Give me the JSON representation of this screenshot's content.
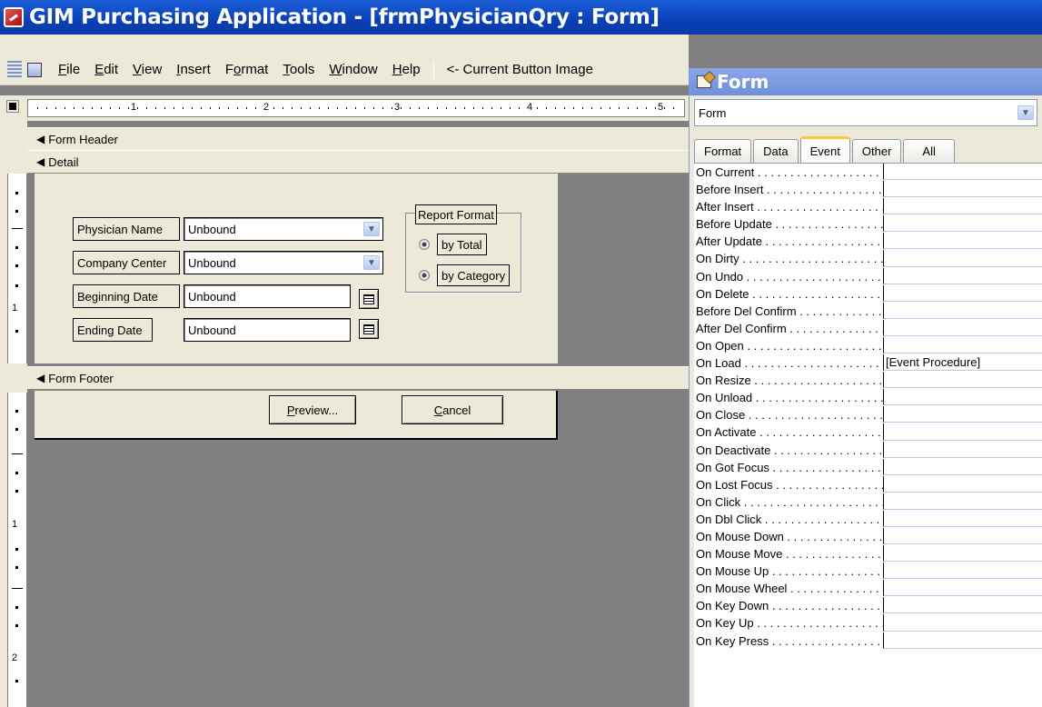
{
  "window": {
    "title": "GIM Purchasing Application - [frmPhysicianQry : Form]"
  },
  "menu": {
    "items": [
      {
        "label": "File",
        "accel": "F",
        "rest": "ile"
      },
      {
        "label": "Edit",
        "accel": "E",
        "rest": "dit"
      },
      {
        "label": "View",
        "accel": "V",
        "rest": "iew"
      },
      {
        "label": "Insert",
        "accel": "I",
        "rest": "nsert"
      },
      {
        "label": "Format",
        "pre": "F",
        "accel": "o",
        "rest": "rmat"
      },
      {
        "label": "Tools",
        "accel": "T",
        "rest": "ools"
      },
      {
        "label": "Window",
        "accel": "W",
        "rest": "indow"
      },
      {
        "label": "Help",
        "accel": "H",
        "rest": "elp"
      }
    ],
    "current_button_image": "<- Current Button Image"
  },
  "ruler": {
    "marks": [
      "1",
      "2",
      "3",
      "4",
      "5"
    ],
    "vertical_marks": [
      "1",
      "1",
      "2"
    ]
  },
  "sections": {
    "header": "Form Header",
    "detail": "Detail",
    "footer": "Form Footer"
  },
  "form": {
    "physician_label": "Physician Name",
    "physician_value": "Unbound",
    "company_label": "Company Center",
    "company_value": "Unbound",
    "begin_label": "Beginning Date",
    "begin_value": "Unbound",
    "end_label": "Ending Date",
    "end_value": "Unbound",
    "report_format_label": "Report Format",
    "option_total": "by Total",
    "option_category": "by Category",
    "preview_button": "Preview...",
    "cancel_button": "Cancel"
  },
  "properties": {
    "title": "Form",
    "object_select": "Form",
    "tabs": [
      "Format",
      "Data",
      "Event",
      "Other",
      "All"
    ],
    "active_tab": "Event",
    "rows": [
      {
        "name": "On Current",
        "value": ""
      },
      {
        "name": "Before Insert",
        "value": ""
      },
      {
        "name": "After Insert",
        "value": ""
      },
      {
        "name": "Before Update",
        "value": ""
      },
      {
        "name": "After Update",
        "value": ""
      },
      {
        "name": "On Dirty",
        "value": ""
      },
      {
        "name": "On Undo",
        "value": ""
      },
      {
        "name": "On Delete",
        "value": ""
      },
      {
        "name": "Before Del Confirm",
        "value": ""
      },
      {
        "name": "After Del Confirm",
        "value": ""
      },
      {
        "name": "On Open",
        "value": ""
      },
      {
        "name": "On Load",
        "value": "[Event Procedure]"
      },
      {
        "name": "On Resize",
        "value": ""
      },
      {
        "name": "On Unload",
        "value": ""
      },
      {
        "name": "On Close",
        "value": ""
      },
      {
        "name": "On Activate",
        "value": ""
      },
      {
        "name": "On Deactivate",
        "value": ""
      },
      {
        "name": "On Got Focus",
        "value": ""
      },
      {
        "name": "On Lost Focus",
        "value": ""
      },
      {
        "name": "On Click",
        "value": ""
      },
      {
        "name": "On Dbl Click",
        "value": ""
      },
      {
        "name": "On Mouse Down",
        "value": ""
      },
      {
        "name": "On Mouse Move",
        "value": ""
      },
      {
        "name": "On Mouse Up",
        "value": ""
      },
      {
        "name": "On Mouse Wheel",
        "value": ""
      },
      {
        "name": "On Key Down",
        "value": ""
      },
      {
        "name": "On Key Up",
        "value": ""
      },
      {
        "name": "On Key Press",
        "value": ""
      }
    ]
  },
  "icons": {
    "app": "access-app-icon",
    "combo": "chevron-down-icon",
    "calendar": "calendar-icon",
    "section_marker": "section-arrow-icon"
  },
  "colors": {
    "title_bar": "#0a3fb8",
    "property_title": "#7a96df",
    "design_surface": "#ece9d8",
    "workspace": "#808080"
  }
}
